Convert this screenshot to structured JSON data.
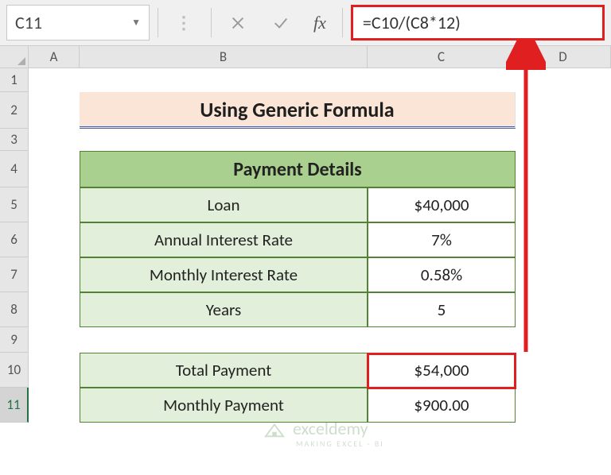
{
  "name_box": "C11",
  "formula": "=C10/(C8*12)",
  "columns": {
    "A": "A",
    "B": "B",
    "C": "C",
    "D": "D"
  },
  "rows": [
    "1",
    "2",
    "3",
    "4",
    "5",
    "6",
    "7",
    "8",
    "9",
    "10",
    "11"
  ],
  "title": "Using Generic Formula",
  "table_header": "Payment Details",
  "details": [
    {
      "label": "Loan",
      "value": "$40,000"
    },
    {
      "label": "Annual Interest Rate",
      "value": "7%"
    },
    {
      "label": "Monthly Interest Rate",
      "value": "0.58%"
    },
    {
      "label": "Years",
      "value": "5"
    }
  ],
  "totals": [
    {
      "label": "Total Payment",
      "value": "$54,000"
    },
    {
      "label": "Monthly Payment",
      "value": "$900.00"
    }
  ],
  "fx_label": "fx",
  "watermark": {
    "text": "exceldemy",
    "sub": "MAKING EXCEL - BI"
  }
}
